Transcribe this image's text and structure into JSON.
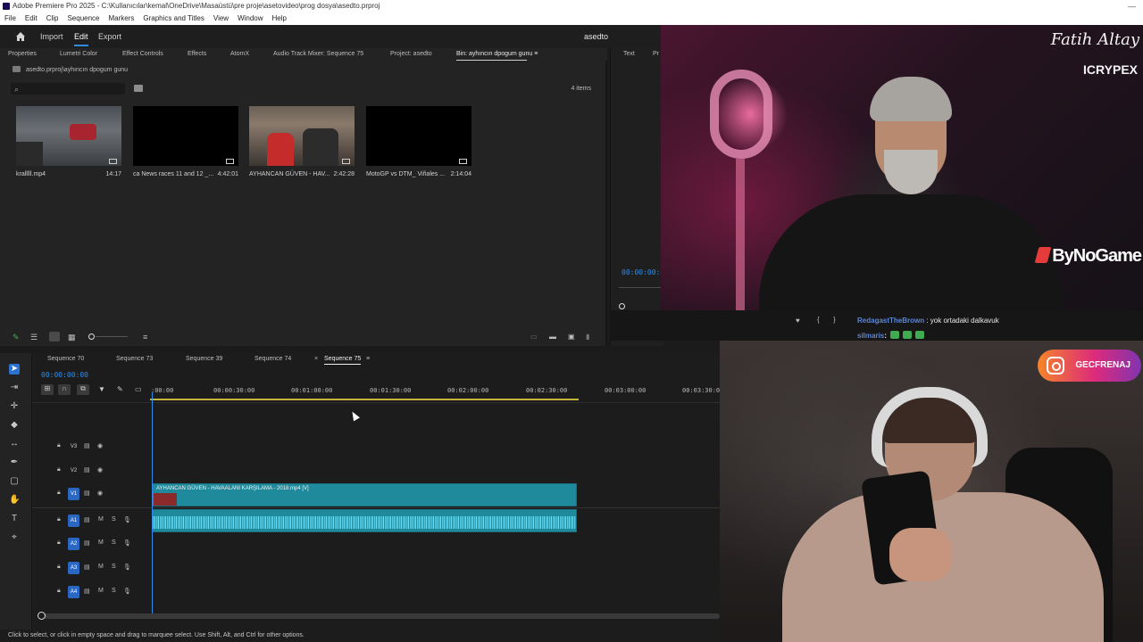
{
  "window": {
    "title": "Adobe Premiere Pro 2025 - C:\\Kullanıcılar\\kemal\\OneDrive\\Masaüstü\\pre proje\\asetovideo\\prog dosya\\asedto.prproj",
    "min": "—"
  },
  "menu": [
    "File",
    "Edit",
    "Clip",
    "Sequence",
    "Markers",
    "Graphics and Titles",
    "View",
    "Window",
    "Help"
  ],
  "workspace": {
    "items": [
      "Import",
      "Edit",
      "Export"
    ],
    "active": "Edit",
    "project_title": "asedto"
  },
  "panel_tabs": [
    "Properties",
    "Lumetri Color",
    "Effect Controls",
    "Effects",
    "AtomX",
    "Audio Track Mixer: Sequence 75",
    "Project: asedto",
    "Bin: ayhıncın dpogum gunu"
  ],
  "right_tabs": [
    "Text",
    "Pr"
  ],
  "project": {
    "breadcrumb": "asedto.prproj\\ayhıncın dpogum gunu",
    "items_count": "4 items",
    "clips": [
      {
        "name": "kralllll.mp4",
        "duration": "14:17"
      },
      {
        "name": "ca News races 11 and 12 _...",
        "duration": "4:42:01"
      },
      {
        "name": "AYHANCAN GÜVEN - HAV...",
        "duration": "2:42:28"
      },
      {
        "name": "MotoGP vs DTM_ Viñales ...",
        "duration": "2:14:04"
      }
    ]
  },
  "program": {
    "timecode": "00:00:00:0"
  },
  "timeline": {
    "tabs": [
      "Sequence 70",
      "Sequence 73",
      "Sequence 39",
      "Sequence 74",
      "Sequence 75"
    ],
    "active_tab": "Sequence 75",
    "timecode": "00:00:00:00",
    "ruler": [
      ":00:00",
      "00:00:30:00",
      "00:01:00:00",
      "00:01:30:00",
      "00:02:00:00",
      "00:02:30:00",
      "00:03:00:00",
      "00:03:30:00"
    ],
    "video_tracks": [
      "V3",
      "V2",
      "V1"
    ],
    "audio_tracks": [
      "A1",
      "A2",
      "A3",
      "A4"
    ],
    "video_clip_label": "AYHANCAN GÜVEN - HAVAALANI KARŞILAMA - 2018.mp4 [V]",
    "mute": "M",
    "solo": "S"
  },
  "status": "Click to select, or click in empty space and drag to marquee select. Use Shift, Alt, and Ctrl for other options.",
  "overlay": {
    "name": "Fatih Altay",
    "sub": "ICRYPEX",
    "brand": "ByNoGame",
    "instagram": "GECFRENAJ",
    "chat": [
      {
        "user": "RedagastTheBrown",
        "text": ": yok ortadaki dalkavuk"
      },
      {
        "user": "silmaris",
        "text": ":"
      }
    ]
  }
}
